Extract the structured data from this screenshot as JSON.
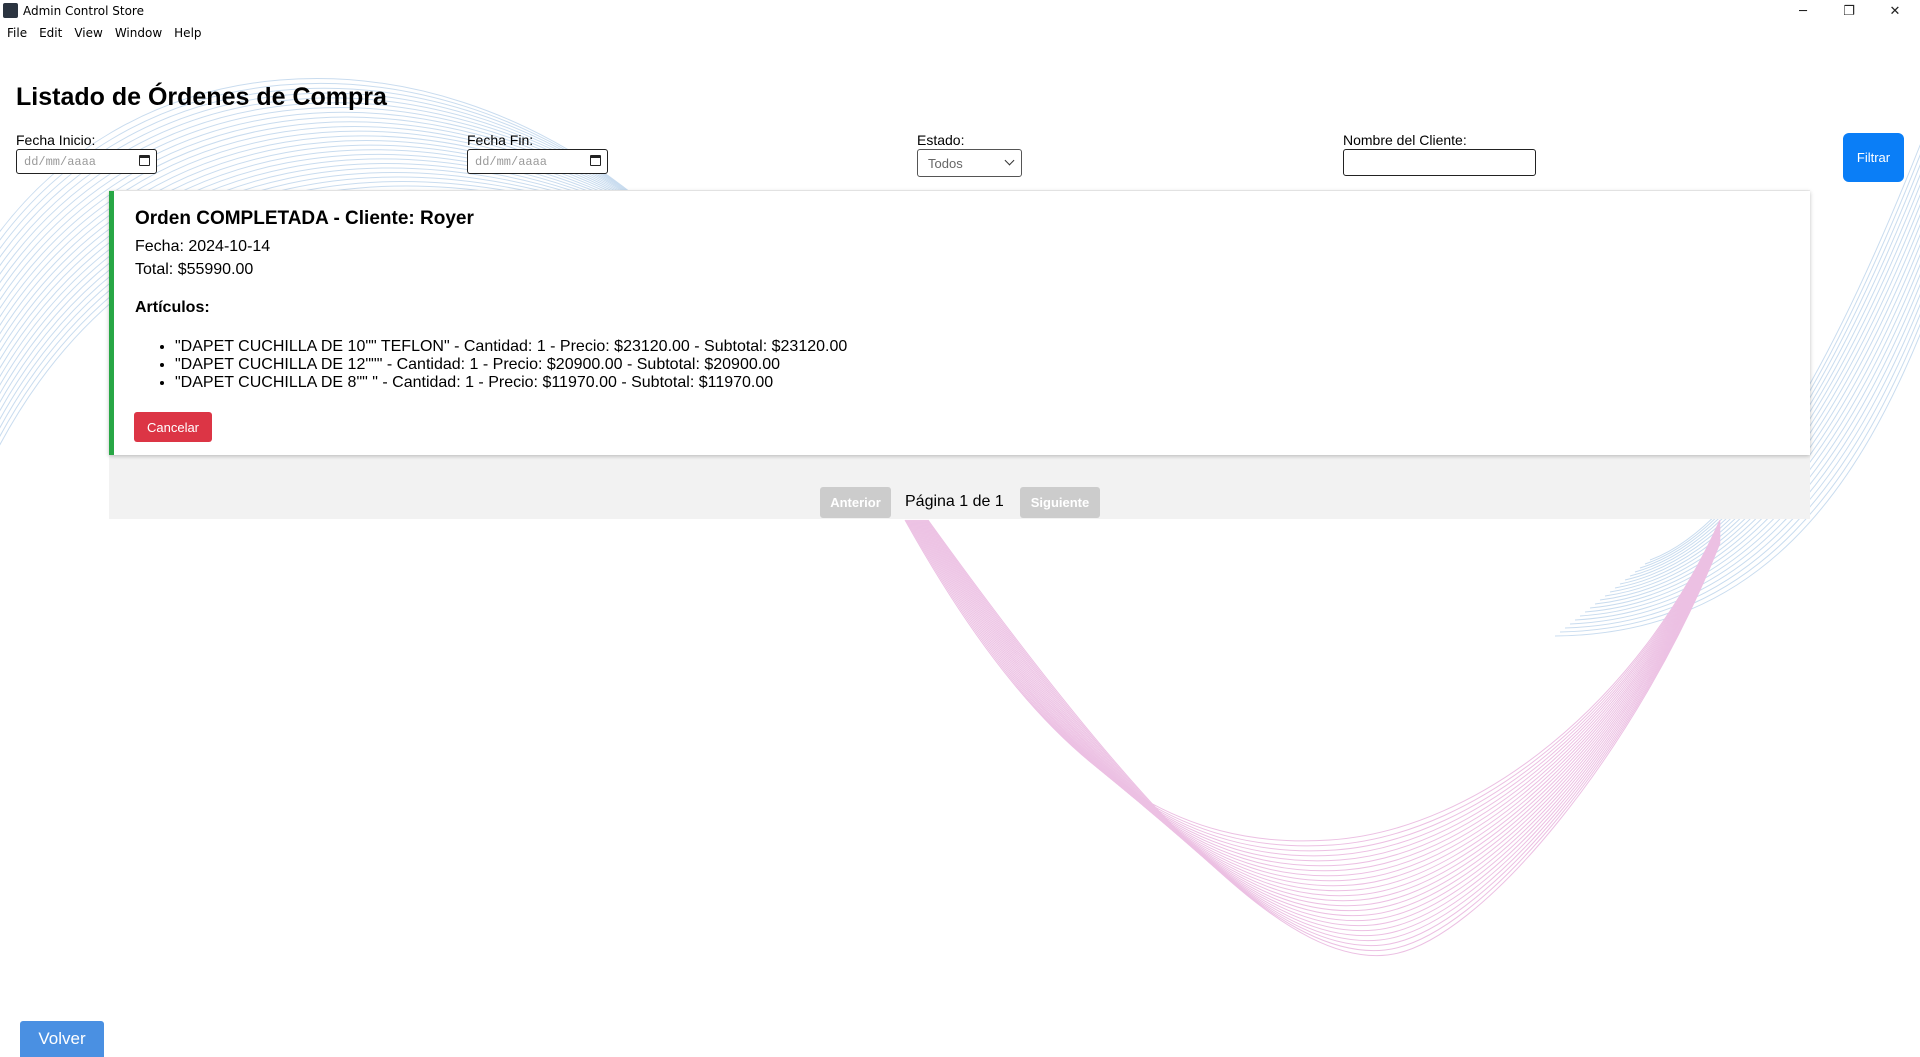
{
  "window": {
    "title": "Admin Control Store",
    "minimize_glyph": "─",
    "maximize_glyph": "❐",
    "close_glyph": "✕"
  },
  "menu": [
    "File",
    "Edit",
    "View",
    "Window",
    "Help"
  ],
  "page": {
    "title": "Listado de Órdenes de Compra"
  },
  "filters": {
    "start_date_label": "Fecha Inicio:",
    "start_date_placeholder": "dd/mm/aaaa",
    "end_date_label": "Fecha Fin:",
    "end_date_placeholder": "dd/mm/aaaa",
    "status_label": "Estado:",
    "status_value": "Todos",
    "client_label": "Nombre del Cliente:",
    "client_value": "",
    "filter_button": "Filtrar"
  },
  "orders": [
    {
      "title": "Orden COMPLETADA - Cliente: Royer",
      "date": "Fecha: 2024-10-14",
      "total": "Total: $55990.00",
      "items_heading": "Artículos:",
      "items": [
        "\"DAPET CUCHILLA DE 10\"\" TEFLON\" - Cantidad: 1 - Precio: $23120.00 - Subtotal: $23120.00",
        "\"DAPET CUCHILLA DE 12\"\"\" - Cantidad: 1 - Precio: $20900.00 - Subtotal: $20900.00",
        "\"DAPET CUCHILLA DE 8\"\" \" - Cantidad: 1 - Precio: $11970.00 - Subtotal: $11970.00"
      ],
      "cancel_button": "Cancelar",
      "status_color": "#28a745"
    }
  ],
  "pagination": {
    "prev": "Anterior",
    "info": "Página 1 de 1",
    "next": "Siguiente"
  },
  "back_button": "Volver",
  "colors": {
    "primary": "#0a7ef7",
    "danger": "#dc3545",
    "back": "#4a90e2",
    "disabled": "#cccccc"
  }
}
